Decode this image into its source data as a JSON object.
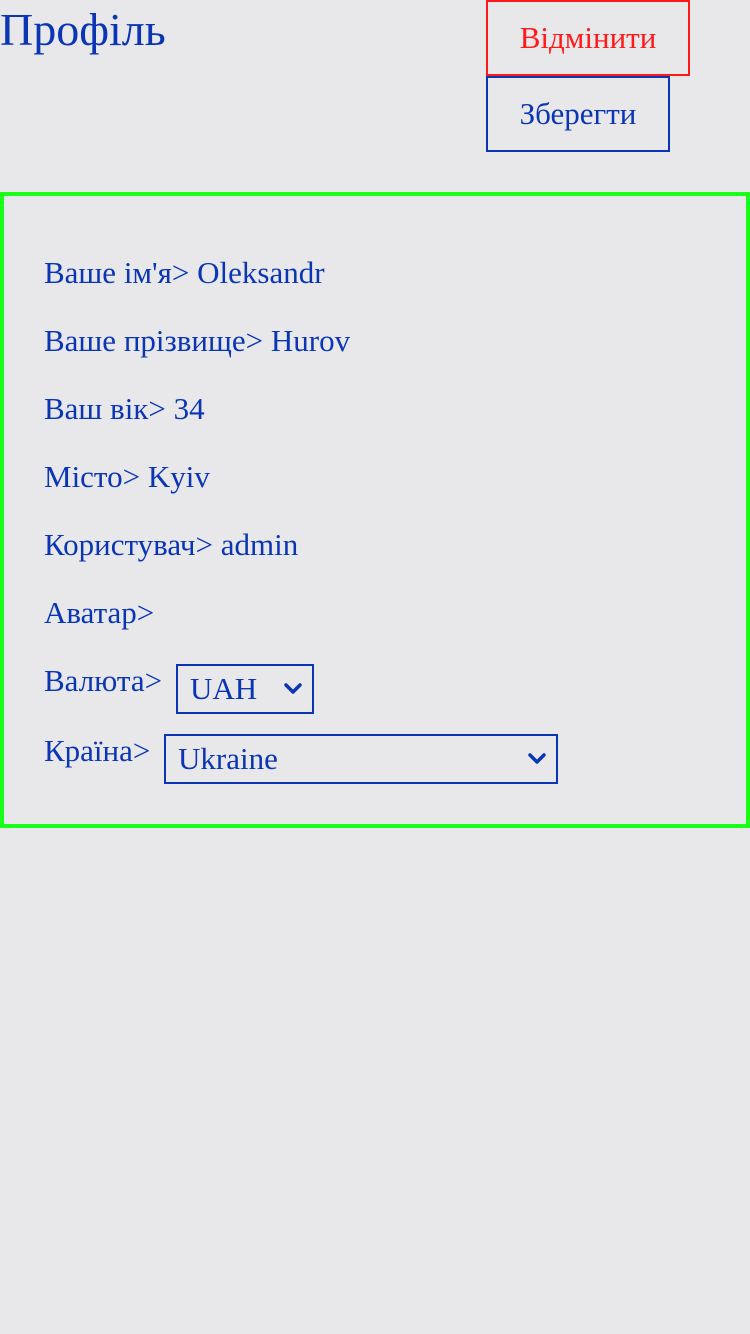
{
  "header": {
    "title": "Профіль",
    "cancel_label": "Відмінити",
    "save_label": "Зберегти"
  },
  "profile": {
    "name_label": "Ваше ім'я>",
    "name_value": "Oleksandr",
    "surname_label": "Ваше прізвище>",
    "surname_value": "Hurov",
    "age_label": "Ваш вік>",
    "age_value": "34",
    "city_label": "Місто>",
    "city_value": "Kyiv",
    "user_label": "Користувач>",
    "user_value": "admin",
    "avatar_label": "Аватар>",
    "currency_label": "Валюта>",
    "currency_value": "UAH",
    "country_label": "Країна>",
    "country_value": "Ukraine"
  },
  "colors": {
    "text": "#0a35b5",
    "cancel": "#ff1a1a",
    "panel_border": "#18ff18",
    "background": "#e8e8ea"
  },
  "icons": {
    "select_arrow": "chevron-down-icon"
  }
}
